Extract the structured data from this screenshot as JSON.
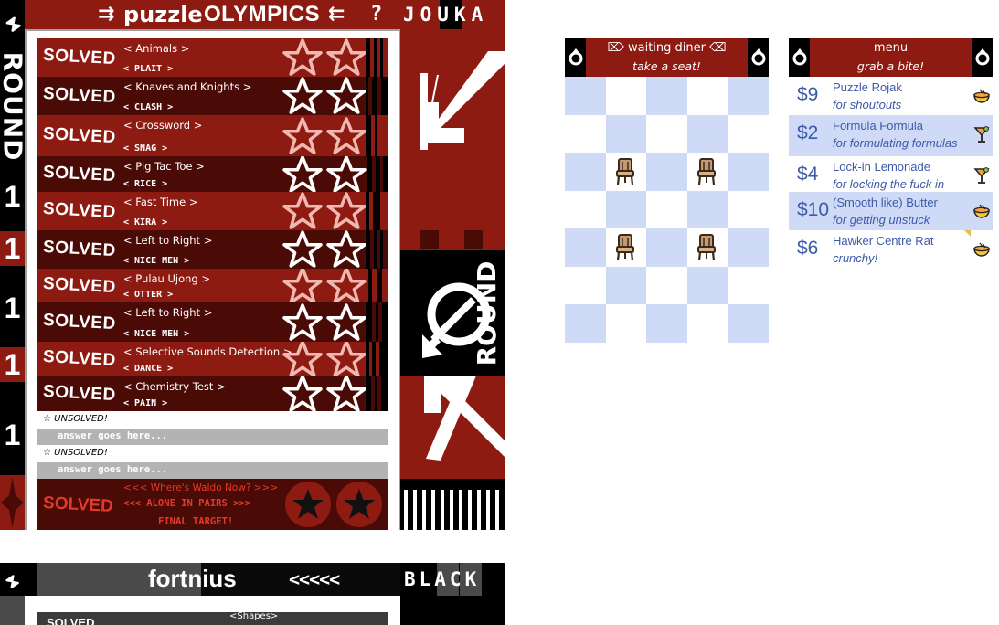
{
  "round1": {
    "title_arrows_left": "⇉",
    "title_puzzle": "puzzle",
    "title_olympics": "OLYMPICS",
    "title_arrows_right": "⇇",
    "title_question": "?",
    "title_team": "JOUKA",
    "side_word": "ROUND",
    "side_number": "1",
    "vertical_label": "ROUND",
    "rows": [
      {
        "status": "SOLVED",
        "puzzle": "< Animals >",
        "answer": "< PLAIT >",
        "shade": "red",
        "star_style": "pink"
      },
      {
        "status": "SOLVED",
        "puzzle": "< Knaves and Knights >",
        "answer": "< CLASH >",
        "shade": "dark",
        "star_style": "white"
      },
      {
        "status": "SOLVED",
        "puzzle": "< Crossword >",
        "answer": "< SNAG >",
        "shade": "red",
        "star_style": "pink"
      },
      {
        "status": "SOLVED",
        "puzzle": "< Pig Tac Toe >",
        "answer": "< RICE >",
        "shade": "dark",
        "star_style": "white"
      },
      {
        "status": "SOLVED",
        "puzzle": "< Fast Time >",
        "answer": "< KIRA >",
        "shade": "red",
        "star_style": "pink"
      },
      {
        "status": "SOLVED",
        "puzzle": "< Left to Right >",
        "answer": "< NICE MEN >",
        "shade": "dark",
        "star_style": "white"
      },
      {
        "status": "SOLVED",
        "puzzle": "< Pulau Ujong >",
        "answer": "< OTTER >",
        "shade": "red",
        "star_style": "pink"
      },
      {
        "status": "SOLVED",
        "puzzle": "< Left to Right >",
        "answer": "< NICE MEN >",
        "shade": "dark",
        "star_style": "white"
      },
      {
        "status": "SOLVED",
        "puzzle": "< Selective Sounds Detection >",
        "answer": "< DANCE >",
        "shade": "red",
        "star_style": "pink"
      },
      {
        "status": "SOLVED",
        "puzzle": "< Chemistry Test >",
        "answer": "< PAIN >",
        "shade": "dark",
        "star_style": "white"
      }
    ],
    "unsolved": [
      {
        "label": "☆ UNSOLVED!",
        "placeholder": "answer goes here..."
      },
      {
        "label": "☆ UNSOLVED!",
        "placeholder": "answer goes here..."
      }
    ],
    "final": {
      "status": "SOLVED",
      "puzzle": "<<< Where's Waldo Now? >>>",
      "answer": "<<< ALONE IN PAIRS >>>",
      "note": "FINAL TARGET!"
    },
    "colors": {
      "red": "#8e1b12",
      "dark": "#4a0a06",
      "pink_star": "#f0b8b0"
    }
  },
  "round2": {
    "title": "fortnius",
    "chevrons": "<<<<<",
    "team": "BLACK",
    "first_row_status": "SOLVED",
    "first_row_puzzle": "<Shapes>"
  },
  "diner": {
    "title": "⌦ waiting diner ⌫",
    "subtitle": "take a seat!",
    "cols": 5,
    "rows": 7,
    "chairs": [
      [
        2,
        1
      ],
      [
        2,
        3
      ],
      [
        4,
        1
      ],
      [
        4,
        3
      ]
    ],
    "colors": {
      "blue": "#cfdaf6",
      "white": "#ffffff"
    }
  },
  "menu": {
    "title": "menu",
    "subtitle": "grab a bite!",
    "items": [
      {
        "price": "$9",
        "name": "Puzzle Rojak",
        "desc": "for shoutouts",
        "icon": "bowl-icon"
      },
      {
        "price": "$2",
        "name": "Formula Formula",
        "desc": "for formulating formulas",
        "icon": "cocktail-icon"
      },
      {
        "price": "$4",
        "name": "Lock-in Lemonade",
        "desc": "for locking the fuck in",
        "icon": "cocktail-icon"
      },
      {
        "price": "$10",
        "name": "(Smooth like) Butter",
        "desc": "for getting unstuck",
        "icon": "bowl-icon"
      },
      {
        "price": "$6",
        "name": "Hawker Centre Rat",
        "desc": "crunchy!",
        "icon": "bowl-icon"
      }
    ]
  }
}
